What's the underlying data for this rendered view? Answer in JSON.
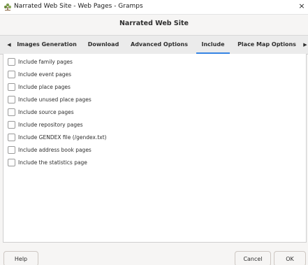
{
  "window": {
    "title": "Narrated Web Site - Web Pages - Gramps",
    "close_symbol": "×",
    "app_icon": "gramps-tree-icon"
  },
  "header": {
    "title": "Narrated Web Site"
  },
  "tabs": {
    "prev_arrow": "◀",
    "next_arrow": "▶",
    "items": [
      {
        "label": "Images Generation"
      },
      {
        "label": "Download"
      },
      {
        "label": "Advanced Options"
      },
      {
        "label": "Include"
      },
      {
        "label": "Place Map Options"
      }
    ],
    "active": "Include",
    "accent_color": "#3584e4"
  },
  "options": [
    {
      "label": "Include family pages",
      "checked": false
    },
    {
      "label": "Include event pages",
      "checked": false
    },
    {
      "label": "Include place pages",
      "checked": false
    },
    {
      "label": "Include unused place pages",
      "checked": false
    },
    {
      "label": "Include source pages",
      "checked": false
    },
    {
      "label": "Include repository pages",
      "checked": false
    },
    {
      "label": "Include GENDEX file (/gendex.txt)",
      "checked": false
    },
    {
      "label": "Include address book pages",
      "checked": false
    },
    {
      "label": "Include the statistics page",
      "checked": false
    }
  ],
  "buttons": {
    "help": "Help",
    "cancel": "Cancel",
    "ok": "OK"
  }
}
